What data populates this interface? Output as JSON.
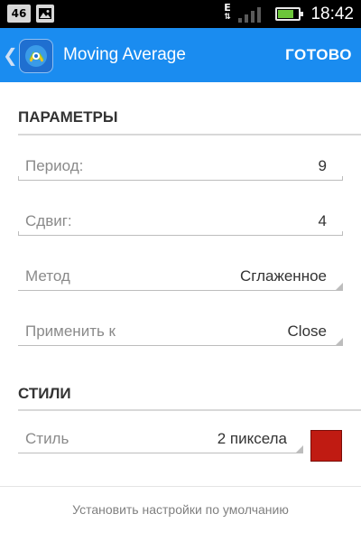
{
  "status_bar": {
    "network_badge": "46",
    "network_type": "E",
    "time": "18:42",
    "battery_level": 0.7
  },
  "app_bar": {
    "background": "#1a8cf0",
    "title": "Moving Average",
    "done_label": "ГОТОВО"
  },
  "parameters": {
    "header": "ПАРАМЕТРЫ",
    "period": {
      "label": "Период:",
      "value": "9"
    },
    "shift": {
      "label": "Сдвиг:",
      "value": "4"
    },
    "method": {
      "label": "Метод",
      "value": "Сглаженное"
    },
    "apply_to": {
      "label": "Применить к",
      "value": "Close"
    }
  },
  "styles": {
    "header": "СТИЛИ",
    "style": {
      "label": "Стиль",
      "value": "2 пиксела"
    },
    "color": "#c01b12"
  },
  "footer": {
    "reset_label": "Установить настройки по умолчанию"
  }
}
